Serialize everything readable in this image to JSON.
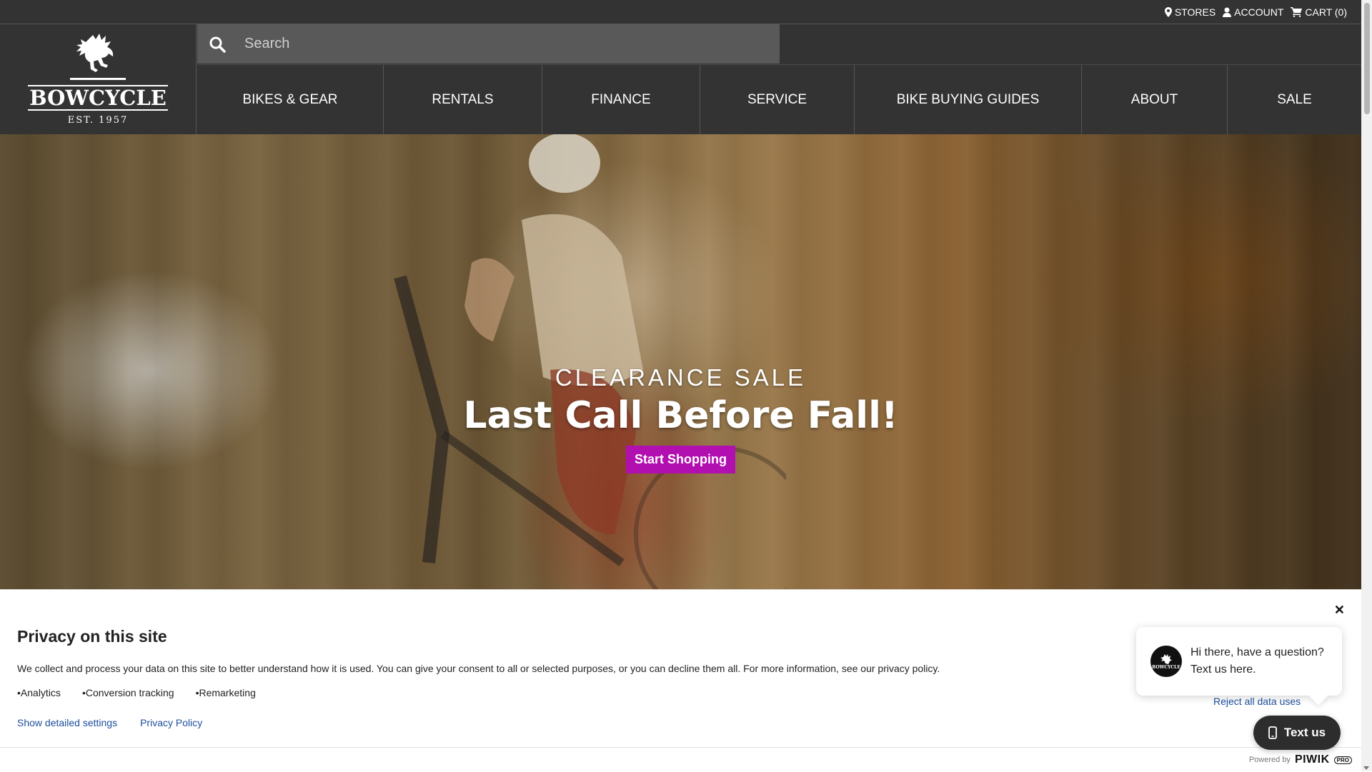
{
  "topbar": {
    "stores": "STORES",
    "account": "ACCOUNT",
    "cart": "CART (0)"
  },
  "logo": {
    "name": "BOWCYCLE",
    "est": "EST. 1957"
  },
  "search": {
    "placeholder": "Search"
  },
  "nav": {
    "items": [
      {
        "label": "BIKES & GEAR"
      },
      {
        "label": "RENTALS"
      },
      {
        "label": "FINANCE"
      },
      {
        "label": "SERVICE"
      },
      {
        "label": "BIKE BUYING GUIDES"
      },
      {
        "label": "ABOUT"
      },
      {
        "label": "SALE"
      }
    ]
  },
  "hero": {
    "eyebrow": "CLEARANCE SALE",
    "title": "Last Call Before Fall!",
    "cta": "Start Shopping",
    "cta_color": "#b10fb0"
  },
  "privacy": {
    "title": "Privacy on this site",
    "description": "We collect and process your data on this site to better understand how it is used. You can give your consent to all or selected purposes, or you can decline them all. For more information, see our privacy policy.",
    "purposes": [
      "Analytics",
      "Conversion tracking",
      "Remarketing"
    ],
    "show_settings": "Show detailed settings",
    "policy": "Privacy Policy",
    "reject": "Reject all data uses",
    "powered_by": "Powered by",
    "brand": "PIWIK",
    "brand_suffix": "PRO"
  },
  "chat": {
    "message": "Hi there, have a question? Text us here.",
    "button": "Text us",
    "avatar_text": "BOWCYCLE"
  },
  "colors": {
    "header_bg": "#333333",
    "search_bg": "#595959",
    "link": "#1d4e9e"
  }
}
